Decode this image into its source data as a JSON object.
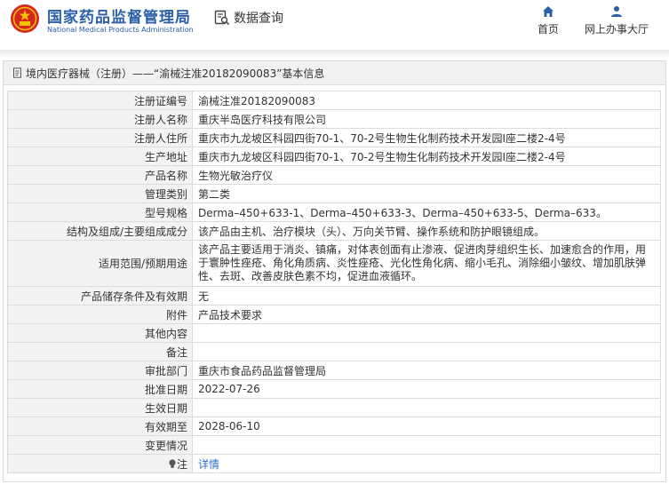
{
  "header": {
    "brand_cn": "国家药品监督管理局",
    "brand_en": "National Medical Products Administration",
    "search_label": "数据查询",
    "nav": [
      {
        "label": "首页",
        "icon": "home-icon"
      },
      {
        "label": "网上办事大厅",
        "icon": "user-icon"
      }
    ]
  },
  "panel": {
    "title": "境内医疗器械（注册）——“渝械注准20182090083”基本信息"
  },
  "details": [
    {
      "key": "注册证编号",
      "value": "渝械注准20182090083"
    },
    {
      "key": "注册人名称",
      "value": "重庆半岛医疗科技有限公司"
    },
    {
      "key": "注册人住所",
      "value": "重庆市九龙坡区科园四街70-1、70-2号生物生化制药技术开发园Ⅰ座二楼2-4号"
    },
    {
      "key": "生产地址",
      "value": "重庆市九龙坡区科园四街70-1、70-2号生物生化制药技术开发园Ⅰ座二楼2-4号"
    },
    {
      "key": "产品名称",
      "value": "生物光敏治疗仪"
    },
    {
      "key": "管理类别",
      "value": "第二类"
    },
    {
      "key": "型号规格",
      "value": "Derma–450+633-1、Derma–450+633-3、Derma–450+633-5、Derma–633。"
    },
    {
      "key": "结构及组成/主要组成成分",
      "value": "该产品由主机、治疗模块（头）、万向关节臂、操作系统和防护眼镜组成。"
    },
    {
      "key": "适用范围/预期用途",
      "value": "该产品主要适用于消炎、镇痛，对体表创面有止渗液、促进肉芽组织生长、加速愈合的作用，用于寰肿性痤疮、角化角质病、炎性痤疮、光化性角化病、缩小毛孔、消除细小皱纹、增加肌肤弹性、去斑、改善皮肤色素不均，促进血液循环。"
    },
    {
      "key": "产品储存条件及有效期",
      "value": "无"
    },
    {
      "key": "附件",
      "value": "产品技术要求"
    },
    {
      "key": "其他内容",
      "value": ""
    },
    {
      "key": "备注",
      "value": ""
    },
    {
      "key": "审批部门",
      "value": "重庆市食品药品监督管理局"
    },
    {
      "key": "批准日期",
      "value": "2022-07-26"
    },
    {
      "key": "生效日期",
      "value": ""
    },
    {
      "key": "有效期至",
      "value": "2028-06-10"
    },
    {
      "key": "变更情况",
      "value": ""
    },
    {
      "key": "注",
      "value": "详情"
    }
  ],
  "colors": {
    "brand_blue": "#2b60a8",
    "link_blue": "#2b6fd1",
    "key_cell_bg": "#f3f3f3",
    "border": "#dcdcdc"
  }
}
